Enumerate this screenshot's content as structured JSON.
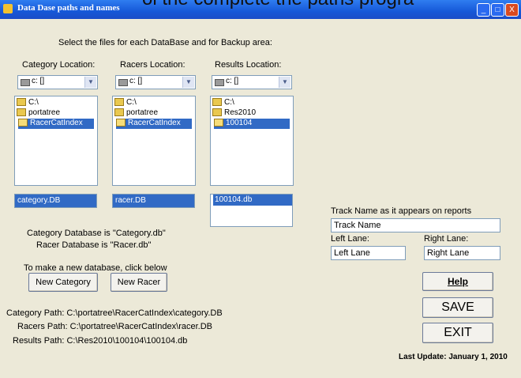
{
  "overlay": {
    "text": "ol the complete the paths progra"
  },
  "window": {
    "title": "Data Dase paths and names",
    "controls": {
      "minimize": "_",
      "maximize": "□",
      "close": "X"
    }
  },
  "heading": "Select the files for each DataBase and for Backup area:",
  "columns": [
    {
      "label": "Category Location:",
      "drive": "c: []",
      "folders": [
        "C:\\",
        "portatree",
        "RacerCatIndex"
      ],
      "file": "category.DB"
    },
    {
      "label": "Racers Location:",
      "drive": "c: []",
      "folders": [
        "C:\\",
        "portatree",
        "RacerCatIndex"
      ],
      "file": "racer.DB"
    },
    {
      "label": "Results Location:",
      "drive": "c: []",
      "folders": [
        "C:\\",
        "Res2010",
        "100104"
      ],
      "file": "100104.db"
    }
  ],
  "info": {
    "category_db": "Category Database is \"Category.db\"",
    "racer_db": "Racer Database is \"Racer.db\"",
    "new_db_hint": "To make a new database, click below"
  },
  "buttons": {
    "new_category": "New Category",
    "new_racer": "New Racer",
    "help": "Help",
    "save": "SAVE",
    "exit": "EXIT"
  },
  "paths": {
    "category": "Category Path: C:\\portatree\\RacerCatIndex\\category.DB",
    "racers": "Racers Path: C:\\portatree\\RacerCatIndex\\racer.DB",
    "results": "Results Path: C:\\Res2010\\100104\\100104.db"
  },
  "track": {
    "label": "Track Name as it appears on reports",
    "value": "Track Name",
    "left_label": "Left Lane:",
    "left_value": "Left Lane",
    "right_label": "Right Lane:",
    "right_value": "Right Lane"
  },
  "footer": {
    "last_update": "Last Update: January 1, 2010"
  },
  "colors": {
    "titlebar": "#1658d8",
    "selection": "#316ac5",
    "window_bg": "#ece9d8"
  }
}
